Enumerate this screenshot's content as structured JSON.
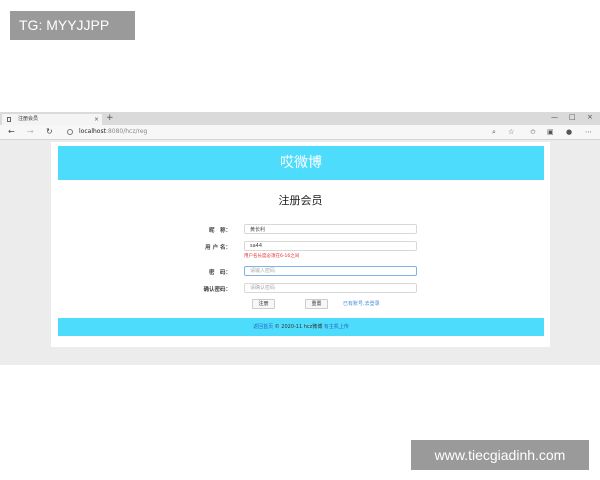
{
  "overlay": {
    "tag": "TG: MYYJJPP",
    "watermark": "www.tiecgiadinh.com"
  },
  "browser": {
    "tab_title": "注册会员",
    "tab_close": "×",
    "new_tab": "+",
    "window_controls": [
      "—",
      "□",
      "×"
    ],
    "nav": {
      "back": "←",
      "forward": "→",
      "refresh": "↻"
    },
    "url_host": "localhost",
    "url_path": ":8080/hcz/reg",
    "toolbar_icons": [
      "search-icon",
      "star-icon",
      "favorites-icon",
      "collections-icon",
      "profile-icon",
      "menu-icon"
    ]
  },
  "page": {
    "banner_title": "哎微博",
    "form_title": "注册会员",
    "fields": [
      {
        "label": "昵　称：",
        "value": "黄长利",
        "placeholder": ""
      },
      {
        "label": "用 户 名：",
        "value": "sa44",
        "placeholder": ""
      },
      {
        "label": "密　码：",
        "value": "",
        "placeholder": "请输入密码"
      },
      {
        "label": "确认密码：",
        "value": "",
        "placeholder": "请确认密码"
      }
    ],
    "username_hint": "用户名长度必须在6-16之间",
    "buttons": {
      "register": "注册",
      "reset": "重置"
    },
    "login_link": "已有账号,去登录",
    "footer": {
      "link": "返回首页",
      "copyright": " © 2020-11 hcz微博 ",
      "suffix": "有主机上传"
    }
  },
  "colors": {
    "accent": "#4ddcfb",
    "error": "#e03030",
    "link": "#4a8fd6"
  }
}
